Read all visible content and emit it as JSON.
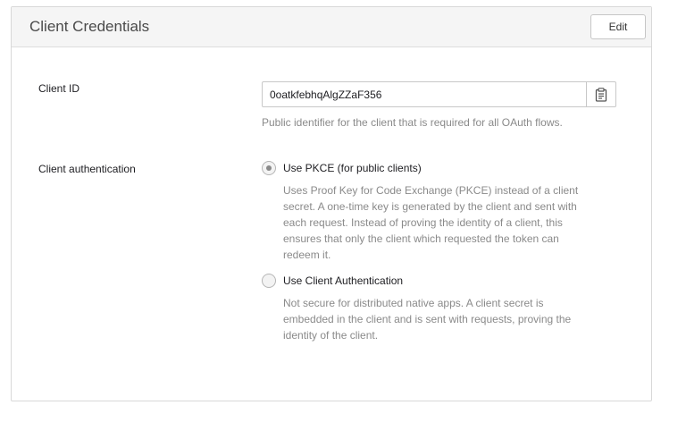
{
  "panel": {
    "title": "Client Credentials",
    "edit_label": "Edit"
  },
  "client_id": {
    "label": "Client ID",
    "value": "0oatkfebhqAlgZZaF356",
    "help": "Public identifier for the client that is required for all OAuth flows.",
    "copy_icon": "clipboard-icon"
  },
  "client_auth": {
    "label": "Client authentication",
    "options": [
      {
        "label": "Use PKCE (for public clients)",
        "selected": true,
        "description_lines": [
          "Uses Proof Key for Code Exchange (PKCE) instead of a client",
          "secret. A one-time key is generated by the client and sent with",
          "each request. Instead of proving the identity of a client, this",
          "ensures that only the client which requested the token can",
          "redeem it."
        ]
      },
      {
        "label": "Use Client Authentication",
        "selected": false,
        "description_lines": [
          "Not secure for distributed native apps. A client secret is",
          "embedded in the client and is sent with requests, proving the",
          "identity of the client."
        ]
      }
    ]
  },
  "colors": {
    "header_bg": "#f5f5f5",
    "border": "#d8d8d8",
    "muted_text": "#8a8a8a",
    "text": "#1d1d21"
  }
}
